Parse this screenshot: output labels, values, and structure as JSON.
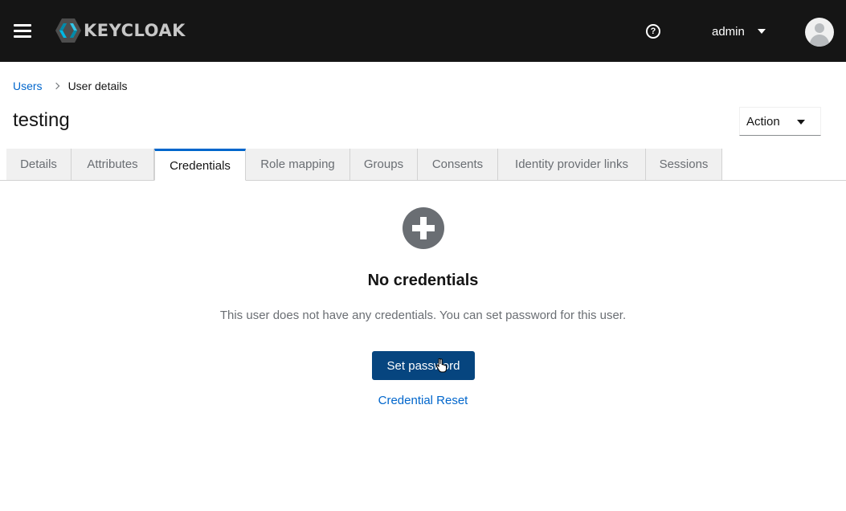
{
  "masthead": {
    "brand_text": "KEYCLOAK",
    "brand_color": "#c7c7c7",
    "background_color": "#151515",
    "menu_icon": "hamburger-icon",
    "help_icon": "question-circle-icon",
    "help_glyph": "?",
    "user_name": "admin",
    "avatar_icon": "user-avatar-icon"
  },
  "breadcrumb": {
    "items": [
      {
        "label": "Users"
      },
      {
        "label": "User details"
      }
    ]
  },
  "page": {
    "title": "testing"
  },
  "action_select": {
    "label": "Action"
  },
  "tabs": [
    {
      "label": "Details",
      "active": false
    },
    {
      "label": "Attributes",
      "active": false
    },
    {
      "label": "Credentials",
      "active": true
    },
    {
      "label": "Role mapping",
      "active": false
    },
    {
      "label": "Groups",
      "active": false
    },
    {
      "label": "Consents",
      "active": false
    },
    {
      "label": "Identity provider links",
      "active": false
    },
    {
      "label": "Sessions",
      "active": false
    }
  ],
  "empty_state": {
    "icon": "plus-circle-icon",
    "title": "No credentials",
    "body": "This user does not have any credentials. You can set password for this user.",
    "primary_button": "Set password",
    "secondary_link": "Credential Reset"
  },
  "colors": {
    "primary": "#06457f",
    "link": "#0066cc",
    "active_tab_border": "#0066cc"
  }
}
